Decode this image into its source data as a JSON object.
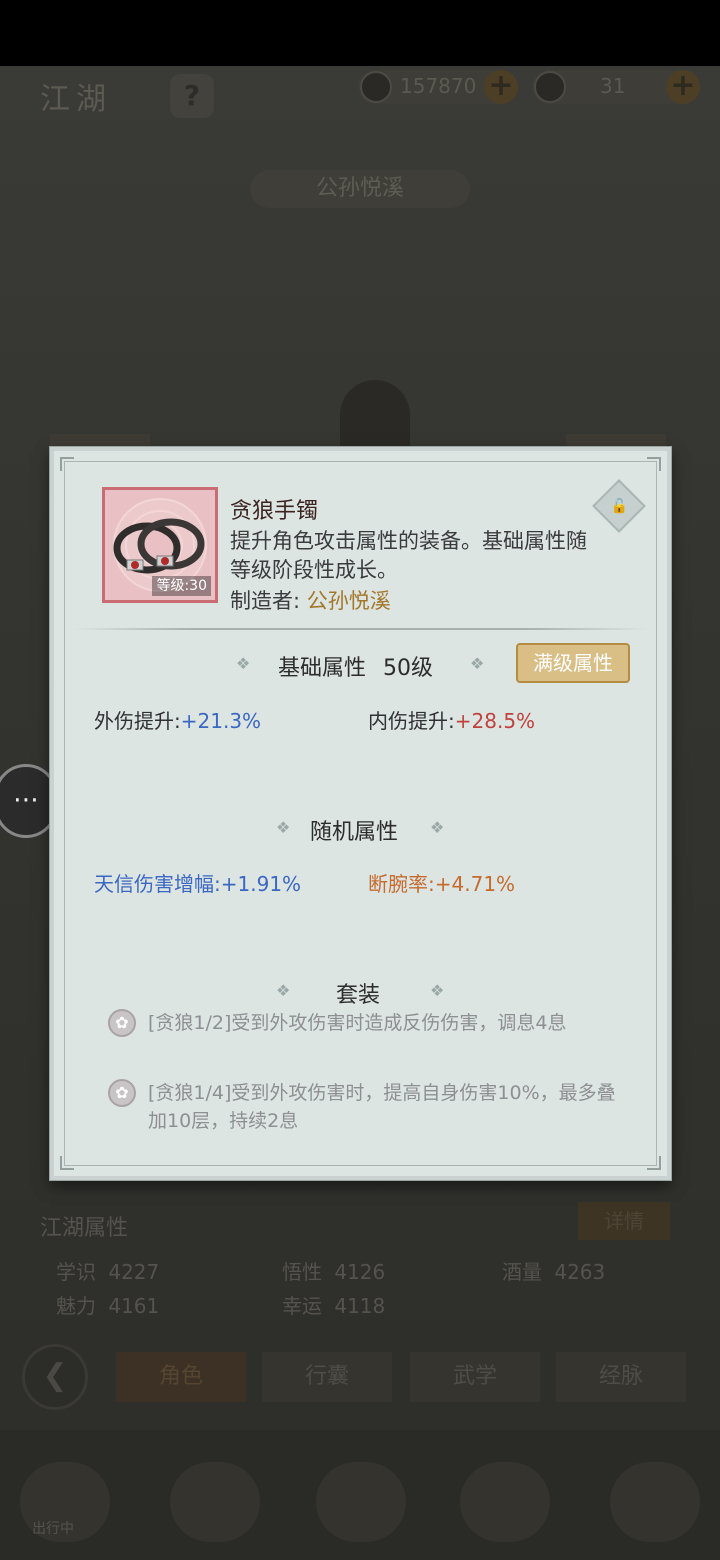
{
  "top_bar": {
    "title": "江湖",
    "help_label": "?",
    "coins": "157870",
    "silver": "31",
    "plus_label": "+"
  },
  "character_name": "公孙悦溪",
  "background_panel": {
    "attr_title": "江湖属性",
    "detail_button": "详情",
    "stats": [
      {
        "label": "学识",
        "value": "4227"
      },
      {
        "label": "悟性",
        "value": "4126"
      },
      {
        "label": "酒量",
        "value": "4263"
      },
      {
        "label": "魅力",
        "value": "4161"
      },
      {
        "label": "幸运",
        "value": "4118"
      }
    ],
    "tabs": [
      "角色",
      "行囊",
      "武学",
      "经脉"
    ],
    "nav_label": "出行中"
  },
  "popup": {
    "item_name": "贪狼手镯",
    "item_level": "等级:30",
    "description": "提升角色攻击属性的装备。基础属性随等级阶段性成长。",
    "maker_label": "制造者:",
    "maker_name": "公孙悦溪",
    "base_section": {
      "title": "基础属性",
      "level": "50级",
      "max_button": "满级属性",
      "stats": [
        {
          "label": "外伤提升:",
          "value": "+21.3%",
          "color": "#3b67c2"
        },
        {
          "label": "内伤提升:",
          "value": "+28.5%",
          "color": "#c0413c"
        }
      ]
    },
    "random_section": {
      "title": "随机属性",
      "stats": [
        {
          "label": "天信伤害增幅:",
          "value": "+1.91%",
          "color": "#3b67c2"
        },
        {
          "label": "断腕率:",
          "value": "+4.71%",
          "color": "#c56b2e"
        }
      ]
    },
    "set_section": {
      "title": "套装",
      "effects": [
        "[贪狼1/2]受到外攻伤害时造成反伤伤害，调息4息",
        "[贪狼1/4]受到外攻伤害时，提高自身伤害10%，最多叠加10层，持续2息"
      ]
    }
  },
  "colors": {
    "accent_gold": "#a3772a",
    "stat_blue": "#3b67c2",
    "stat_red": "#c0413c",
    "stat_orange": "#c56b2e",
    "popup_bg": "#dde5e3"
  }
}
